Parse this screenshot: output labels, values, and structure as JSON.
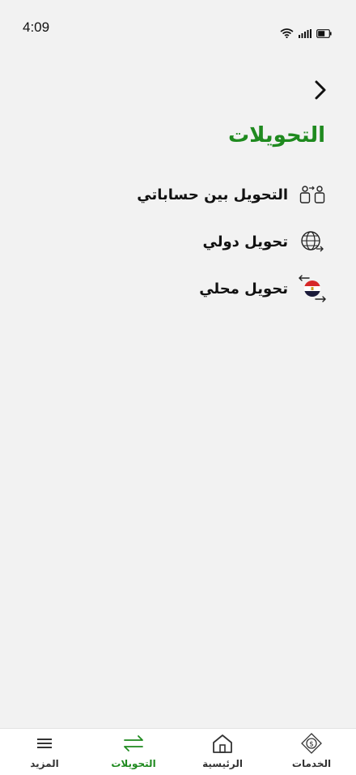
{
  "status_bar": {
    "time": "4:09",
    "icons": [
      "wifi-icon",
      "signal-icon",
      "battery-icon"
    ]
  },
  "header": {
    "title": "التحويلات",
    "back_icon": "chevron-right-icon"
  },
  "menu": {
    "items": [
      {
        "label": "التحويل بين حساباتي",
        "icon": "accounts-transfer-icon"
      },
      {
        "label": "تحويل دولي",
        "icon": "globe-transfer-icon"
      },
      {
        "label": "تحويل محلي",
        "icon": "egypt-flag-transfer-icon"
      }
    ]
  },
  "tabs": [
    {
      "label": "الخدمات",
      "icon": "services-coin-icon"
    },
    {
      "label": "الرئيسية",
      "icon": "home-icon"
    },
    {
      "label": "التحويلات",
      "icon": "transfer-arrows-icon",
      "active": true
    },
    {
      "label": "المزيد",
      "icon": "menu-icon"
    }
  ],
  "colors": {
    "accent": "#1f8a1f",
    "background": "#f2f2f2",
    "text": "#111111"
  }
}
